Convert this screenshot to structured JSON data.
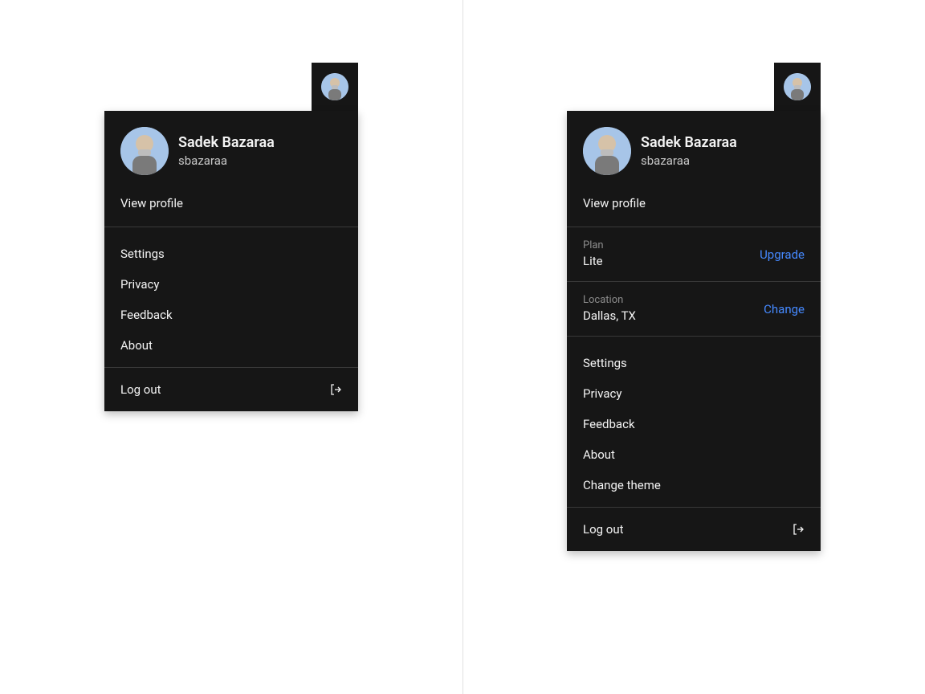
{
  "left": {
    "user": {
      "name": "Sadek Bazaraa",
      "handle": "sbazaraa"
    },
    "view_profile": "View profile",
    "items": [
      "Settings",
      "Privacy",
      "Feedback",
      "About"
    ],
    "logout": "Log out"
  },
  "right": {
    "user": {
      "name": "Sadek Bazaraa",
      "handle": "sbazaraa"
    },
    "view_profile": "View profile",
    "plan": {
      "label": "Plan",
      "value": "Lite",
      "action": "Upgrade"
    },
    "location": {
      "label": "Location",
      "value": "Dallas, TX",
      "action": "Change"
    },
    "items": [
      "Settings",
      "Privacy",
      "Feedback",
      "About",
      "Change theme"
    ],
    "logout": "Log out"
  }
}
